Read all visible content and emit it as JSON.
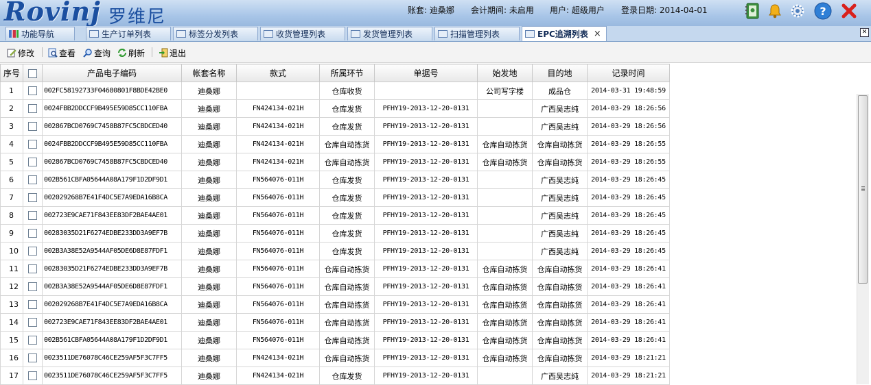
{
  "header": {
    "logo": "Rovinj",
    "logo_cn": "罗维尼",
    "account": "账套: 迪桑娜",
    "period": "会计期间: 未启用",
    "user": "用户: 超级用户",
    "login_date": "登录日期: 2014-04-01",
    "icons": [
      "contacts-icon",
      "bell-icon",
      "gear-icon",
      "help-icon",
      "close-icon"
    ]
  },
  "tabs": [
    {
      "label": "功能导航",
      "active": false
    },
    {
      "label": "生产订单列表",
      "active": false
    },
    {
      "label": "标签分发列表",
      "active": false
    },
    {
      "label": "收货管理列表",
      "active": false
    },
    {
      "label": "发货管理列表",
      "active": false
    },
    {
      "label": "扫描管理列表",
      "active": false
    },
    {
      "label": "EPC追溯列表",
      "active": true,
      "close": "×"
    }
  ],
  "toolbar": {
    "edit": "修改",
    "view": "查看",
    "query": "查询",
    "refresh": "刷新",
    "exit": "退出"
  },
  "table": {
    "headers": [
      "序号",
      "",
      "产品电子编码",
      "帐套名称",
      "款式",
      "所属环节",
      "单据号",
      "始发地",
      "目的地",
      "记录时间"
    ],
    "rows": [
      [
        "1",
        "002FC58192733F04680801F8BDE42BE0",
        "迪桑娜",
        "",
        "仓库收货",
        "",
        "公司写字楼",
        "成品仓",
        "2014-03-31 19:48:59"
      ],
      [
        "2",
        "0024FBB2DDCCF9B495E59D85CC110FBA",
        "迪桑娜",
        "FN424134-021H",
        "仓库发货",
        "PFHY19-2013-12-20-0131",
        "",
        "广西吴志纯",
        "2014-03-29 18:26:56"
      ],
      [
        "3",
        "002867BCD0769C7458B87FC5CBDCED40",
        "迪桑娜",
        "FN424134-021H",
        "仓库发货",
        "PFHY19-2013-12-20-0131",
        "",
        "广西吴志纯",
        "2014-03-29 18:26:56"
      ],
      [
        "4",
        "0024FBB2DDCCF9B495E59D85CC110FBA",
        "迪桑娜",
        "FN424134-021H",
        "仓库自动拣货",
        "PFHY19-2013-12-20-0131",
        "仓库自动拣货",
        "仓库自动拣货",
        "2014-03-29 18:26:55"
      ],
      [
        "5",
        "002867BCD0769C7458B87FC5CBDCED40",
        "迪桑娜",
        "FN424134-021H",
        "仓库自动拣货",
        "PFHY19-2013-12-20-0131",
        "仓库自动拣货",
        "仓库自动拣货",
        "2014-03-29 18:26:55"
      ],
      [
        "6",
        "002B561CBFA05644A08A179F1D2DF9D1",
        "迪桑娜",
        "FN564076-011H",
        "仓库发货",
        "PFHY19-2013-12-20-0131",
        "",
        "广西吴志纯",
        "2014-03-29 18:26:45"
      ],
      [
        "7",
        "002029268B7E41F4DC5E7A9EDA16B8CA",
        "迪桑娜",
        "FN564076-011H",
        "仓库发货",
        "PFHY19-2013-12-20-0131",
        "",
        "广西吴志纯",
        "2014-03-29 18:26:45"
      ],
      [
        "8",
        "002723E9CAE71F843EE83DF2BAE4AE01",
        "迪桑娜",
        "FN564076-011H",
        "仓库发货",
        "PFHY19-2013-12-20-0131",
        "",
        "广西吴志纯",
        "2014-03-29 18:26:45"
      ],
      [
        "9",
        "00283035D21F6274EDBE233DD3A9EF7B",
        "迪桑娜",
        "FN564076-011H",
        "仓库发货",
        "PFHY19-2013-12-20-0131",
        "",
        "广西吴志纯",
        "2014-03-29 18:26:45"
      ],
      [
        "10",
        "002B3A38E52A9544AF05DE6D8E87FDF1",
        "迪桑娜",
        "FN564076-011H",
        "仓库发货",
        "PFHY19-2013-12-20-0131",
        "",
        "广西吴志纯",
        "2014-03-29 18:26:45"
      ],
      [
        "11",
        "00283035D21F6274EDBE233DD3A9EF7B",
        "迪桑娜",
        "FN564076-011H",
        "仓库自动拣货",
        "PFHY19-2013-12-20-0131",
        "仓库自动拣货",
        "仓库自动拣货",
        "2014-03-29 18:26:41"
      ],
      [
        "12",
        "002B3A38E52A9544AF05DE6D8E87FDF1",
        "迪桑娜",
        "FN564076-011H",
        "仓库自动拣货",
        "PFHY19-2013-12-20-0131",
        "仓库自动拣货",
        "仓库自动拣货",
        "2014-03-29 18:26:41"
      ],
      [
        "13",
        "002029268B7E41F4DC5E7A9EDA16B8CA",
        "迪桑娜",
        "FN564076-011H",
        "仓库自动拣货",
        "PFHY19-2013-12-20-0131",
        "仓库自动拣货",
        "仓库自动拣货",
        "2014-03-29 18:26:41"
      ],
      [
        "14",
        "002723E9CAE71F843EE83DF2BAE4AE01",
        "迪桑娜",
        "FN564076-011H",
        "仓库自动拣货",
        "PFHY19-2013-12-20-0131",
        "仓库自动拣货",
        "仓库自动拣货",
        "2014-03-29 18:26:41"
      ],
      [
        "15",
        "002B561CBFA05644A08A179F1D2DF9D1",
        "迪桑娜",
        "FN564076-011H",
        "仓库自动拣货",
        "PFHY19-2013-12-20-0131",
        "仓库自动拣货",
        "仓库自动拣货",
        "2014-03-29 18:26:41"
      ],
      [
        "16",
        "0023511DE76078C46CE259AF5F3C7FF5",
        "迪桑娜",
        "FN424134-021H",
        "仓库自动拣货",
        "PFHY19-2013-12-20-0131",
        "仓库自动拣货",
        "仓库自动拣货",
        "2014-03-29 18:21:21"
      ],
      [
        "17",
        "0023511DE76078C46CE259AF5F3C7FF5",
        "迪桑娜",
        "FN424134-021H",
        "仓库发货",
        "PFHY19-2013-12-20-0131",
        "",
        "广西吴志纯",
        "2014-03-29 18:21:21"
      ]
    ]
  },
  "colors": {
    "header_bg": "#a9c6e8",
    "logo": "#1b4fa0",
    "accent_close": "#d9211c"
  }
}
